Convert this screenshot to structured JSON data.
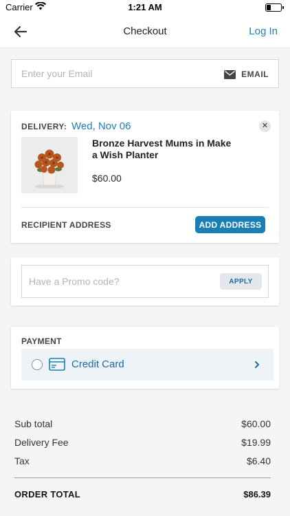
{
  "status_bar": {
    "carrier": "Carrier",
    "time": "1:21 AM",
    "wifi_icon": "wifi-icon",
    "battery_level": 0.3
  },
  "nav": {
    "back_icon": "arrow-left-icon",
    "title": "Checkout",
    "login_label": "Log In"
  },
  "email": {
    "placeholder": "Enter your Email",
    "value": "",
    "button_icon": "envelope-icon",
    "button_label": "EMAIL"
  },
  "delivery": {
    "label": "DELIVERY:",
    "date": "Wed, Nov 06",
    "close_icon": "close-icon",
    "product": {
      "name": "Bronze Harvest Mums in Make a Wish Planter",
      "price": "$60.00",
      "image_icon": "flower-pot-image"
    },
    "recipient_label": "RECIPIENT ADDRESS",
    "add_address_label": "ADD ADDRESS"
  },
  "promo": {
    "placeholder": "Have a Promo code?",
    "value": "",
    "apply_label": "APPLY"
  },
  "payment": {
    "label": "PAYMENT",
    "option_label": "Credit Card",
    "option_icon": "credit-card-icon",
    "chevron_icon": "chevron-right-icon"
  },
  "totals": {
    "rows": [
      {
        "label": "Sub total",
        "value": "$60.00"
      },
      {
        "label": "Delivery Fee",
        "value": "$19.99"
      },
      {
        "label": "Tax",
        "value": "$6.40"
      }
    ],
    "order_total_label": "ORDER TOTAL",
    "order_total_value": "$86.39"
  },
  "colors": {
    "accent": "#1a7fb5",
    "background": "#f5f5f5",
    "card": "#ffffff"
  }
}
